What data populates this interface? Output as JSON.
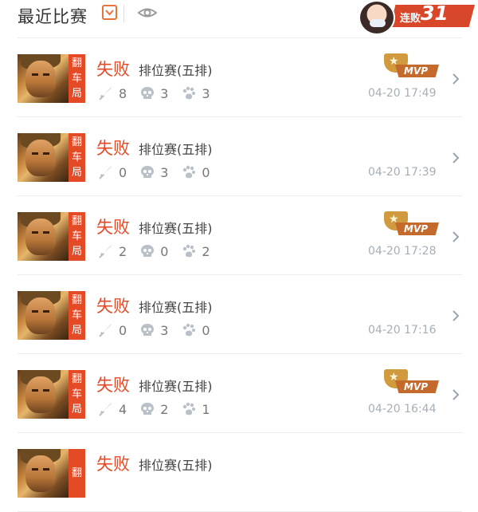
{
  "header": {
    "title": "最近比赛",
    "streak_label": "连败",
    "streak_count": "31"
  },
  "matches": [
    {
      "tag": [
        "翻",
        "车",
        "局"
      ],
      "result": "失败",
      "mode": "排位赛(五排)",
      "kills": "8",
      "deaths": "3",
      "assists": "3",
      "mvp": true,
      "time": "04-20 17:49"
    },
    {
      "tag": [
        "翻",
        "车",
        "局"
      ],
      "result": "失败",
      "mode": "排位赛(五排)",
      "kills": "0",
      "deaths": "3",
      "assists": "0",
      "mvp": false,
      "time": "04-20 17:39"
    },
    {
      "tag": [
        "翻",
        "车",
        "局"
      ],
      "result": "失败",
      "mode": "排位赛(五排)",
      "kills": "2",
      "deaths": "0",
      "assists": "2",
      "mvp": true,
      "time": "04-20 17:28"
    },
    {
      "tag": [
        "翻",
        "车",
        "局"
      ],
      "result": "失败",
      "mode": "排位赛(五排)",
      "kills": "0",
      "deaths": "3",
      "assists": "0",
      "mvp": false,
      "time": "04-20 17:16"
    },
    {
      "tag": [
        "翻",
        "车",
        "局"
      ],
      "result": "失败",
      "mode": "排位赛(五排)",
      "kills": "4",
      "deaths": "2",
      "assists": "1",
      "mvp": true,
      "time": "04-20 16:44"
    },
    {
      "tag": [
        "翻"
      ],
      "result": "失败",
      "mode": "排位赛(五排)",
      "kills": "",
      "deaths": "",
      "assists": "",
      "mvp": false,
      "time": ""
    }
  ],
  "mvp_label": "MVP",
  "icons": {
    "dropdown": "chevron-down-icon",
    "visibility": "eye-icon",
    "kills": "sword-icon",
    "deaths": "skull-icon",
    "assists": "paw-icon",
    "row_action": "chevron-right-icon"
  },
  "colors": {
    "accent": "#e54a26",
    "mvp_gold": "#d29a3e",
    "muted": "#a6aeb8"
  }
}
